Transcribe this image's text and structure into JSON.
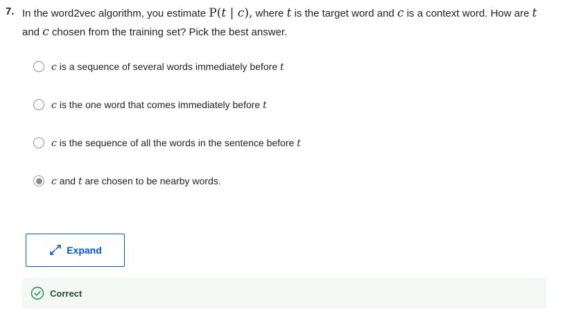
{
  "question": {
    "number": "7.",
    "line1_pre": "In the word2vec algorithm, you estimate ",
    "math_P": "P",
    "math_paren_open": "(",
    "math_t": "t",
    "math_bar": " | ",
    "math_c": "c",
    "math_paren_close": "),",
    "line1_mid": " where ",
    "line1_var_t": "t",
    "line1_post": " is the target word and ",
    "line1_var_c": "c",
    "line1_post2": " is a context word. How are ",
    "line1_var_t2": "t",
    "line2_pre": "and ",
    "line2_var_c": "c",
    "line2_post": " chosen from the training set? Pick the best answer."
  },
  "options": [
    {
      "var1": "c",
      "text": " is a sequence of several words immediately before ",
      "var2": "t",
      "selected": false
    },
    {
      "var1": "c",
      "text": " is the one word that comes immediately before ",
      "var2": "t",
      "selected": false
    },
    {
      "var1": "c",
      "text": " is the sequence of all the words in the sentence before ",
      "var2": "t",
      "selected": false
    },
    {
      "var1": "c",
      "text": " and ",
      "var2": "t",
      "text2": " are chosen to be nearby words.",
      "selected": true
    }
  ],
  "expand": {
    "label": "Expand",
    "icon": "expand-arrows-icon"
  },
  "feedback": {
    "label": "Correct",
    "icon": "check-circle-icon",
    "color": "#1f8354"
  },
  "colors": {
    "accent": "#0056d2",
    "feedback_bg": "#f3f8f4"
  }
}
